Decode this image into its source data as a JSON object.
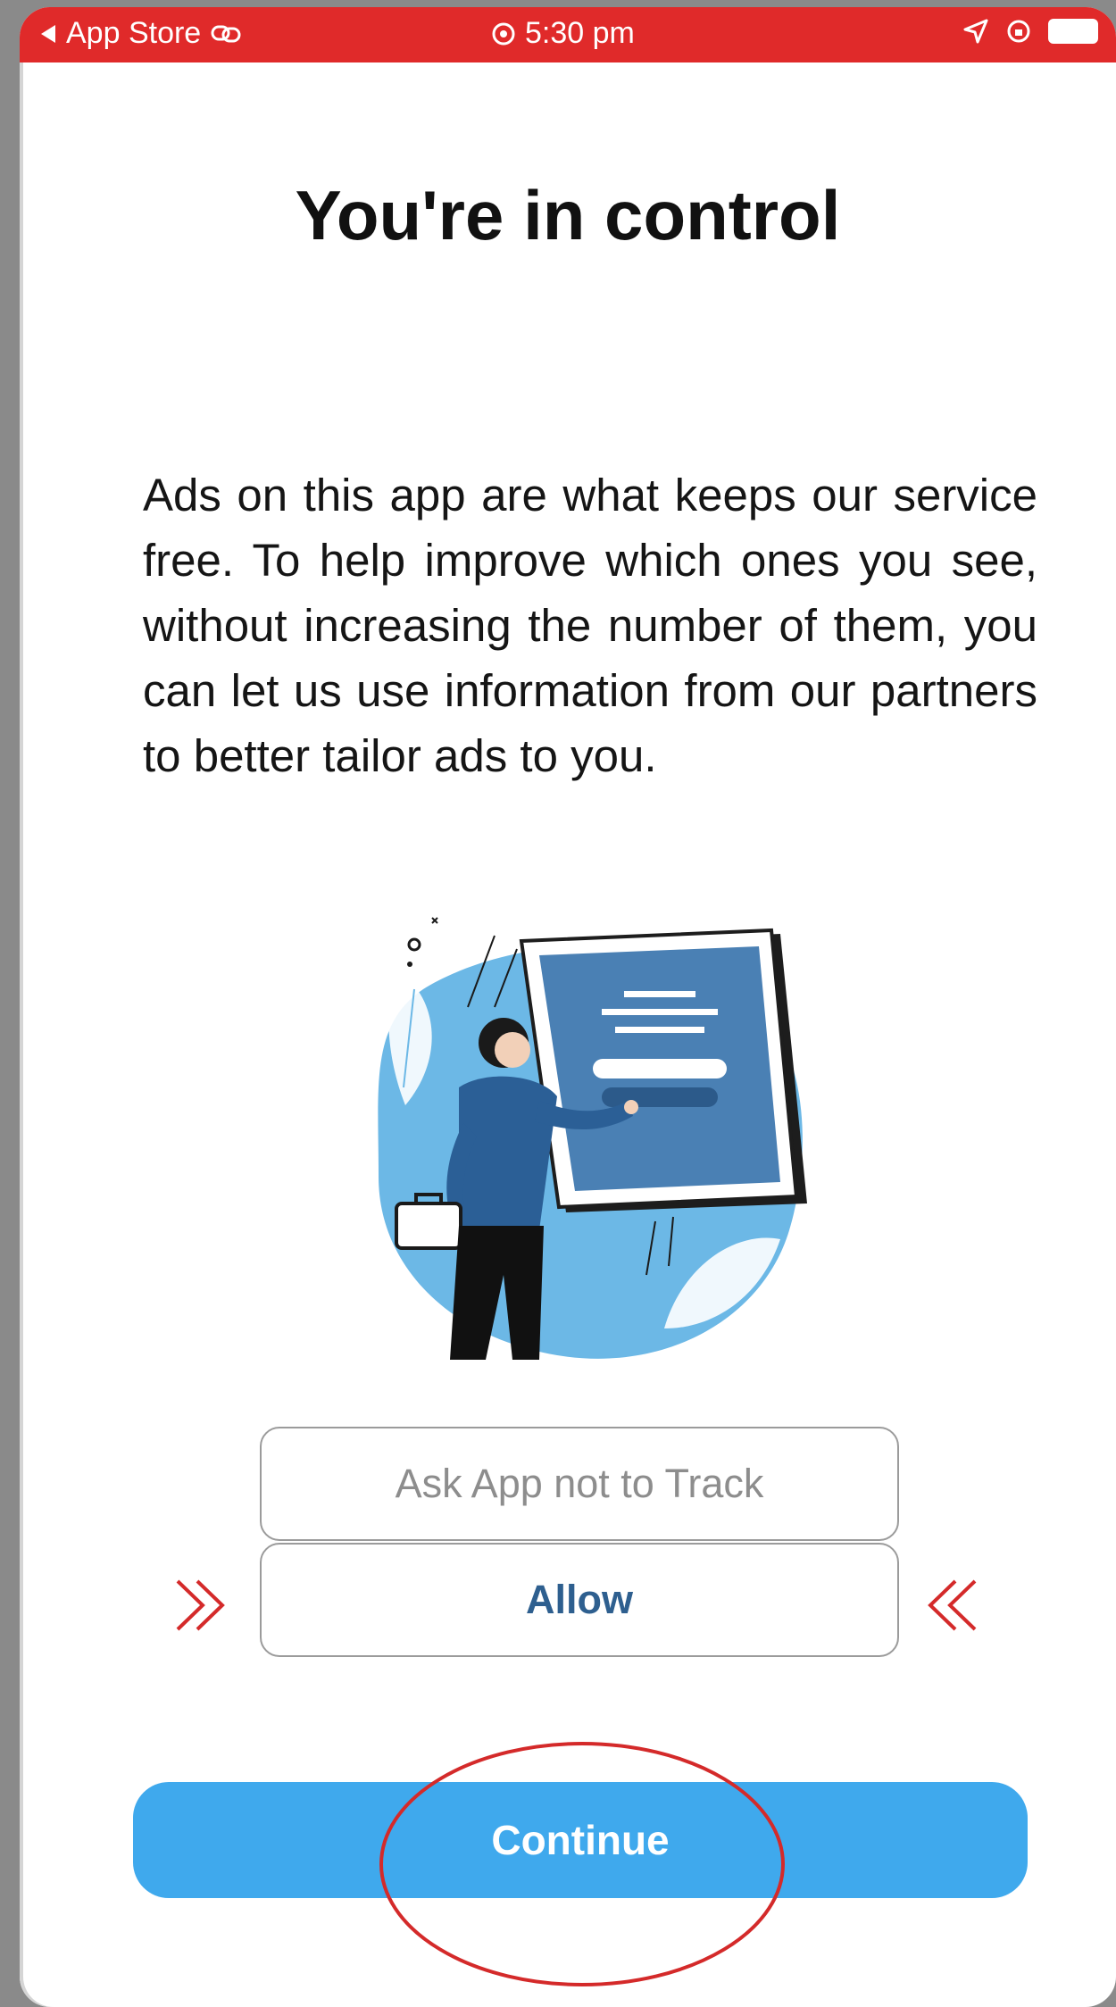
{
  "status_bar": {
    "back_label": "App Store",
    "time": "5:30 pm"
  },
  "title": "You're in control",
  "description": "Ads on this app are what keeps our service free. To help improve which ones you see, without increasing the number of them, you can let us use information from our partners to better tailor ads to you.",
  "illustration": {
    "screen_field_text": "Ask App not to Track",
    "screen_button_text": "Allow"
  },
  "options": {
    "ask_not_track": "Ask App not to Track",
    "allow": "Allow"
  },
  "continue_label": "Continue",
  "colors": {
    "status_bar": "#e02a2a",
    "continue_button": "#3fa9ed",
    "allow_text": "#2e5f8f",
    "annotation_red": "#d42a2a"
  }
}
